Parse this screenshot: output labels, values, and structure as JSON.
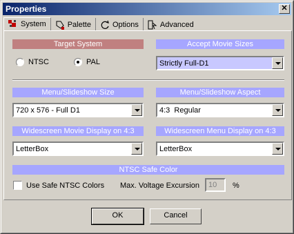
{
  "window": {
    "title": "Properties",
    "close_label": "✕"
  },
  "tabs": [
    {
      "label": "System",
      "icon": "system-icon",
      "active": true
    },
    {
      "label": "Palette",
      "icon": "palette-icon"
    },
    {
      "label": "Options",
      "icon": "options-icon"
    },
    {
      "label": "Advanced",
      "icon": "advanced-icon"
    }
  ],
  "target_system": {
    "header": "Target System",
    "ntsc_label": "NTSC",
    "pal_label": "PAL",
    "selected": "PAL"
  },
  "accept_movie_sizes": {
    "header": "Accept Movie Sizes",
    "value": "Strictly Full-D1"
  },
  "menu_size": {
    "header": "Menu/Slideshow Size",
    "value": "720 x 576 - Full D1"
  },
  "menu_aspect": {
    "header": "Menu/Slideshow Aspect",
    "value": "4:3  Regular"
  },
  "widescreen_movie": {
    "header": "Widescreen Movie Display on 4:3",
    "value": "LetterBox"
  },
  "widescreen_menu": {
    "header": "Widescreen Menu Display on 4:3",
    "value": "LetterBox"
  },
  "ntsc_safe": {
    "header": "NTSC Safe Color",
    "checkbox_label": "Use Safe NTSC Colors",
    "checked": false,
    "voltage_label": "Max. Voltage Excursion",
    "voltage_value": "10",
    "unit": "%"
  },
  "buttons": {
    "ok": "OK",
    "cancel": "Cancel"
  },
  "colors": {
    "header_blue": "#a6a6ff",
    "header_red": "#c08080",
    "title_bar": "#0a246a"
  }
}
